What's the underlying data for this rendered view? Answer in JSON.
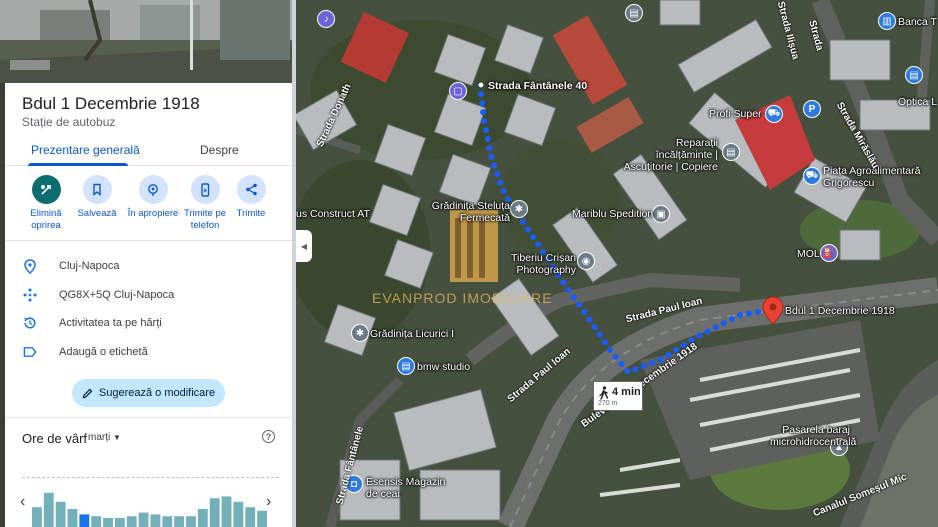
{
  "place": {
    "title": "Bdul 1 Decembrie 1918",
    "subtitle": "Stație de autobuz"
  },
  "tabs": [
    {
      "label": "Prezentare generală",
      "active": true
    },
    {
      "label": "Despre",
      "active": false
    }
  ],
  "actions": [
    {
      "label": "Elimină oprirea",
      "icon": "route-remove-icon"
    },
    {
      "label": "Salvează",
      "icon": "bookmark-icon"
    },
    {
      "label": "În apropiere",
      "icon": "nearby-icon"
    },
    {
      "label": "Trimite pe telefon",
      "icon": "phone-icon"
    },
    {
      "label": "Trimite",
      "icon": "share-icon"
    }
  ],
  "info": [
    {
      "text": "Cluj-Napoca",
      "icon": "location-pin-icon"
    },
    {
      "text": "QG8X+5Q Cluj-Napoca",
      "icon": "plus-code-icon"
    },
    {
      "text": "Activitatea ta pe hărți",
      "icon": "history-icon"
    },
    {
      "text": "Adaugă o etichetă",
      "icon": "label-icon"
    }
  ],
  "suggest_label": "Sugerează o modificare",
  "peak": {
    "title": "Ore de vârf",
    "day": "marți",
    "bars": [
      0.55,
      0.95,
      0.7,
      0.5,
      0.35,
      0.3,
      0.25,
      0.25,
      0.3,
      0.4,
      0.35,
      0.3,
      0.3,
      0.3,
      0.5,
      0.8,
      0.85,
      0.7,
      0.55,
      0.45
    ]
  },
  "colors": {
    "accent": "#0b57d0",
    "primary_action": "#0b6d6f",
    "route": "#1a5cff",
    "pin": "#ea4335"
  },
  "map": {
    "route_card": {
      "time": "4 min",
      "distance": "270 m"
    },
    "start_label": "Strada Fântânele 40",
    "destination_label": "Bdul 1 Decembrie 1918",
    "watermark": "EVANPROD IMOBILIARE",
    "labels": [
      {
        "text": "Grădinița Steluța Fermecată",
        "icon": "school-icon"
      },
      {
        "text": "Tiberiu Crișan Photography",
        "icon": "camera-icon"
      },
      {
        "text": "Mariblu Spedition",
        "icon": "truck-icon"
      },
      {
        "text": "Reparații încălțăminte | Ascuțitorie | Copiere",
        "icon": "store-icon"
      },
      {
        "text": "Profi Super",
        "icon": "cart-icon"
      },
      {
        "text": "Piața Agroalimentară Grigorescu",
        "icon": "cart-icon"
      },
      {
        "text": "MOL",
        "icon": "fuel-icon"
      },
      {
        "text": "Grădinița Licurici I",
        "icon": "school-icon"
      },
      {
        "text": "bmw studio",
        "icon": "store-icon"
      },
      {
        "text": "Esensis Magazin de ceai",
        "icon": "shopping-bag-icon"
      },
      {
        "text": "Pasarela baraj microhidrocentrală",
        "icon": "landmark-icon"
      },
      {
        "text": "Banca T",
        "icon": "bank-icon"
      },
      {
        "text": "Optica L",
        "icon": "store-icon"
      },
      {
        "text": "us Construct AT",
        "icon": "store-icon"
      }
    ],
    "streets": [
      "Strada Paul Ioan",
      "Strada Paul Ioan",
      "Bulevardul 1 Decembrie 1918",
      "Strada Fântânele",
      "Strada Mirăslău",
      "Strada Donath",
      "Canalul Someșul Mic",
      "Strada Ilișua",
      "Strada"
    ]
  }
}
